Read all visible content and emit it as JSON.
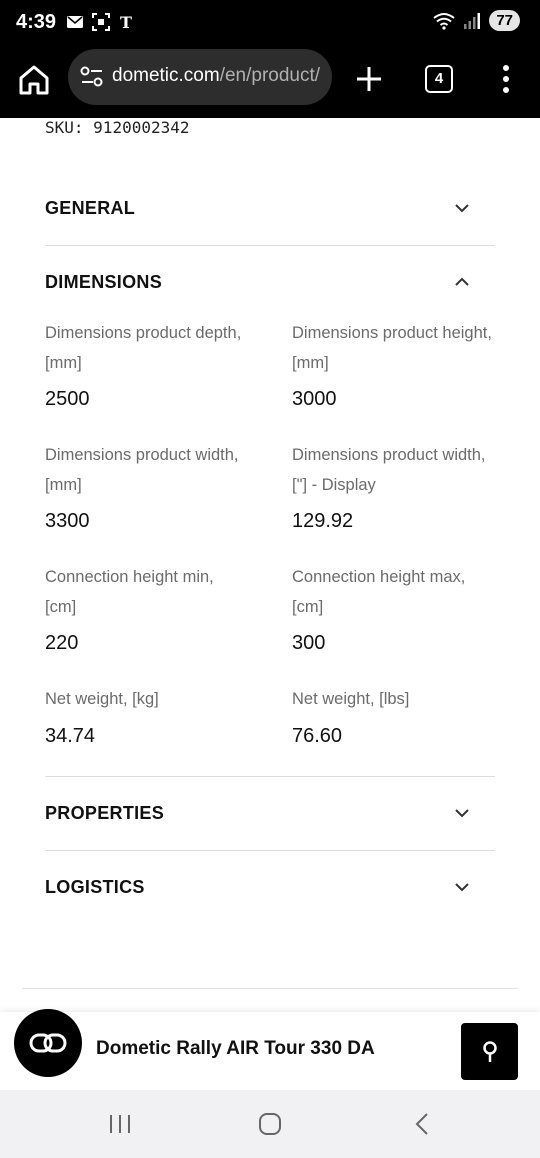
{
  "status_bar": {
    "time": "4:39",
    "battery": "77",
    "left_icons": [
      "mail-icon",
      "screenshot-icon",
      "nyt-icon"
    ],
    "right_icons": [
      "wifi-icon",
      "signal-icon",
      "battery-icon"
    ]
  },
  "browser": {
    "url_domain": "dometic.com",
    "url_path": "/en/product/",
    "tab_count": "4",
    "icons": [
      "home-icon",
      "site-settings-icon",
      "new-tab-icon",
      "more-menu-icon"
    ]
  },
  "page": {
    "sku_label": "SKU:",
    "sku_value": "9120002342",
    "sections": [
      {
        "title": "GENERAL",
        "expanded": false
      },
      {
        "title": "DIMENSIONS",
        "expanded": true
      },
      {
        "title": "PROPERTIES",
        "expanded": false
      },
      {
        "title": "LOGISTICS",
        "expanded": false
      }
    ],
    "specs": [
      {
        "label": "Dimensions product depth, [mm]",
        "value": "2500"
      },
      {
        "label": "Dimensions product height, [mm]",
        "value": "3000"
      },
      {
        "label": "Dimensions product width, [mm]",
        "value": "3300"
      },
      {
        "label": "Dimensions product width, [\"] - Display",
        "value": "129.92"
      },
      {
        "label": "Connection height min, [cm]",
        "value": "220"
      },
      {
        "label": "Connection height max, [cm]",
        "value": "300"
      },
      {
        "label": "Net weight, [kg]",
        "value": "34.74"
      },
      {
        "label": "Net weight, [lbs]",
        "value": "76.60"
      }
    ]
  },
  "product_bar": {
    "name": "Dometic Rally AIR Tour 330 DA",
    "icons": [
      "compare-icon",
      "location-pin-icon"
    ]
  },
  "nav_bar": {
    "icons": [
      "recent-apps-icon",
      "home-nav-icon",
      "back-nav-icon"
    ]
  }
}
